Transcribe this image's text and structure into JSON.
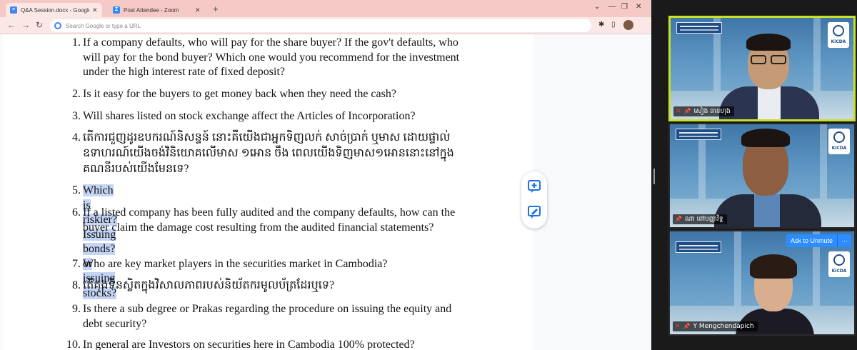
{
  "browser": {
    "tabs": [
      {
        "label": "Q&A Session.docx - Google Docs",
        "icon": "google-docs-icon",
        "color": "#4285f4"
      },
      {
        "label": "Post Attendee - Zoom",
        "icon": "zoom-icon",
        "color": "#2d8cff"
      }
    ],
    "new_tab": "+",
    "omnibox_placeholder": "Search Google or type a URL",
    "window_controls": [
      "minimize",
      "maximize",
      "close"
    ]
  },
  "document": {
    "questions": [
      {
        "num": "1.",
        "text": "If a company defaults, who will pay for the share buyer? If the gov't defaults, who will pay for the bond buyer? Which one would you recommend for the investment under the high interest rate of fixed deposit?"
      },
      {
        "num": "2.",
        "text": "Is it easy for the buyers to get money back when they need the cash?"
      },
      {
        "num": "3.",
        "text": "Will shares listed on stock exchange affect the Articles of Incorporation?"
      },
      {
        "num": "4.",
        "text": "តើការជួញដូរឧបករណ៍និសន្ទន៍ នោះគឺយើងជាអ្នកទិញលក់ សាច់ប្រាក់ ឬមាស ដោយផ្ទាល់ ឧទាហរណ៍យើងចង់វិនិយោគលើមាស ១អោន ចឹង ពេលយើងទិញមាស១អោននោះនៅក្នុងគណនីរបស់យើងមែនទេ?"
      },
      {
        "num": "5.",
        "text": "Which is riskier?  Issuing bonds? or issuing stocks?",
        "highlighted": true
      },
      {
        "num": "6.",
        "text": "If a listed company has been fully audited and the company defaults, how can the buyer claim the damage cost resulting from the audited financial statements?"
      },
      {
        "num": "7.",
        "text": "Who are key market players in the securities market in Cambodia?"
      },
      {
        "num": "8.",
        "text": "តើគុងទិនស្លិតក្នុងវិសាលភាពរបស់និយ័តករមូលប័ត្រដែរឬទេ?"
      },
      {
        "num": "9.",
        "text": "Is there a sub degree or Prakas regarding the procedure on issuing the equity and debt security?"
      },
      {
        "num": "10.",
        "text": "In general are Investors on securities here in Cambodia 100% protected?"
      }
    ],
    "side_tools": [
      "add-comment-icon",
      "suggest-edit-icon"
    ]
  },
  "zoom": {
    "participants": [
      {
        "name": "សៀង ធានហុង",
        "muted": true,
        "pinned": true,
        "speaking": true,
        "logo_text": "KiCDA"
      },
      {
        "name": "ណា ពៅបញ្ញាវិទ្ធ",
        "muted": false,
        "pinned": true,
        "speaking": false,
        "logo_text": "KiCDA"
      },
      {
        "name": "Y Mengchendapich",
        "muted": true,
        "pinned": true,
        "speaking": false,
        "logo_text": "KiCDA",
        "ask_to_unmute": "Ask to Unmute",
        "more": "···"
      }
    ]
  }
}
